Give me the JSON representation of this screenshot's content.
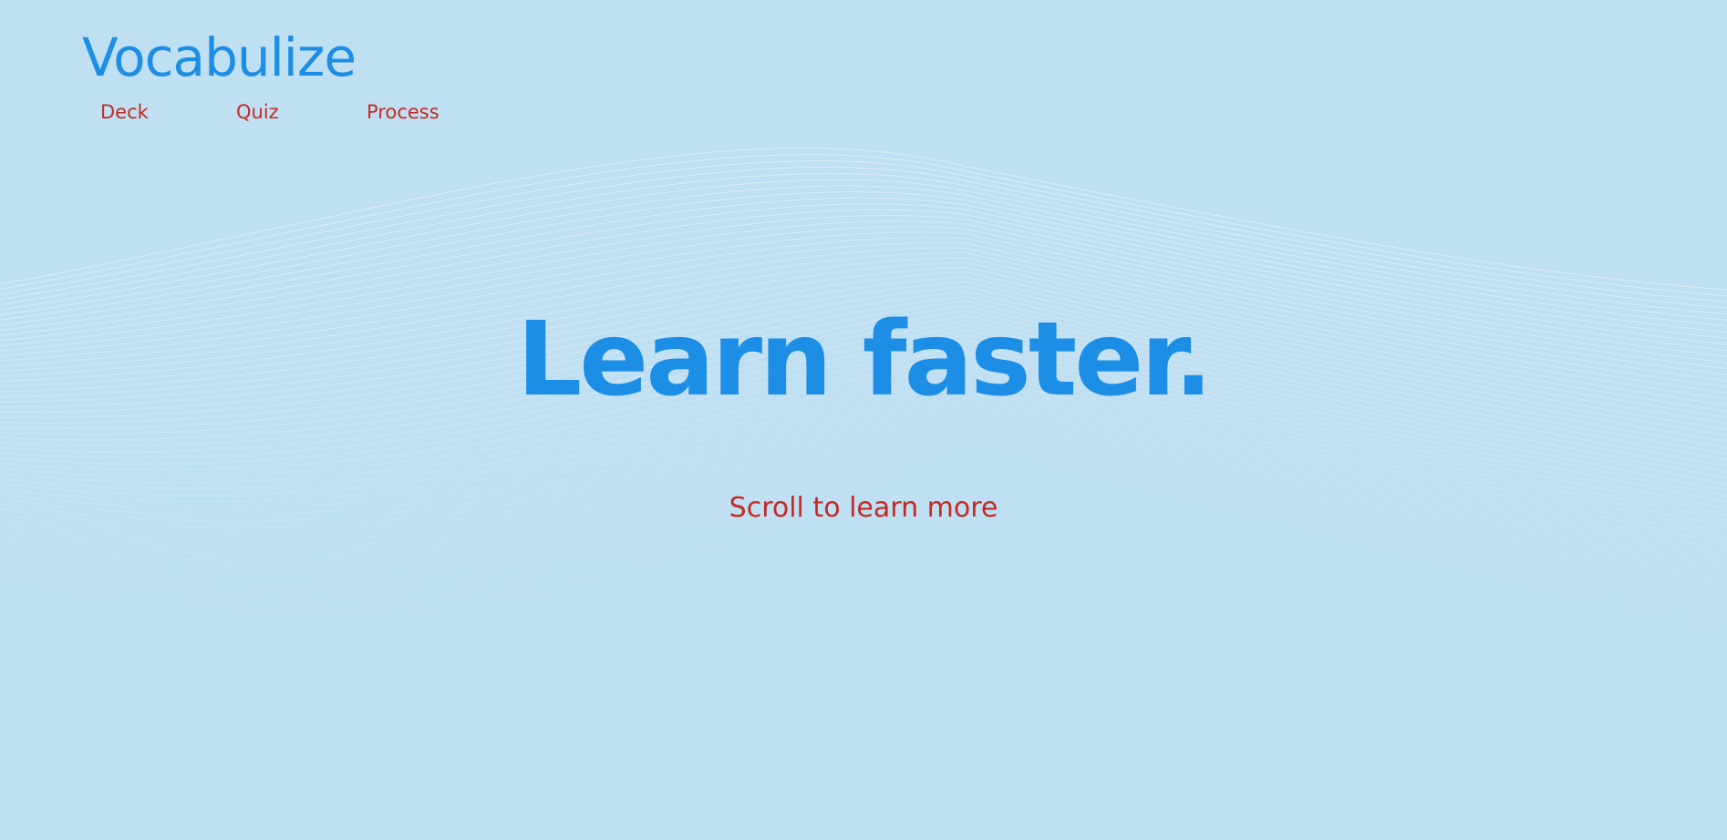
{
  "header": {
    "logo": "Vocabulize"
  },
  "nav": {
    "items": [
      {
        "label": "Deck"
      },
      {
        "label": "Quiz"
      },
      {
        "label": "Process"
      }
    ]
  },
  "hero": {
    "title": "Learn faster.",
    "scroll_hint": "Scroll to learn more"
  },
  "colors": {
    "background": "#bfdff2",
    "primary_blue": "#1d8ee6",
    "accent_red": "#c42b25",
    "wave_lines": "#ffffff"
  }
}
